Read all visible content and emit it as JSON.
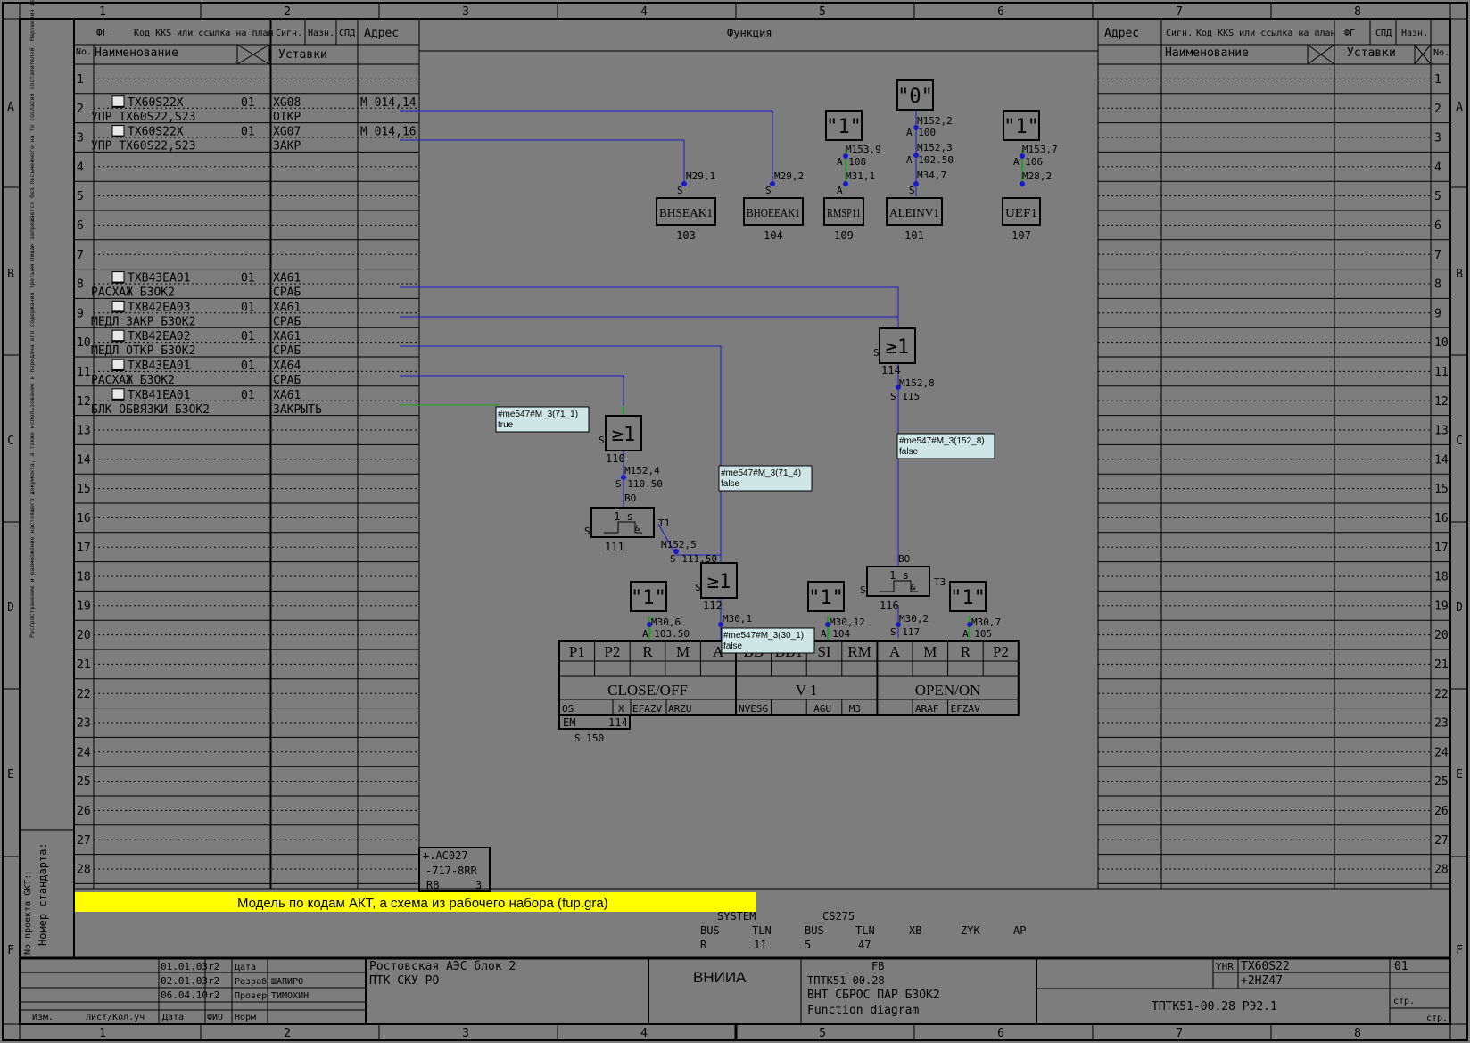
{
  "ruler": {
    "cols": [
      "1",
      "2",
      "3",
      "4",
      "5",
      "6",
      "7",
      "8"
    ],
    "rows": [
      "A",
      "B",
      "C",
      "D",
      "E",
      "F"
    ]
  },
  "left_header": {
    "fg": "ФГ",
    "kks": "Код KKS или ссылка на план",
    "sign": "Сигн.",
    "nazn": "Назн.",
    "spd": "СПД",
    "addr": "Адрес",
    "no": "No.",
    "name": "Наименование",
    "ustavki": "Уставки"
  },
  "function_header": "Функция",
  "right_header": {
    "addr": "Адрес",
    "sign": "Сигн.",
    "kks": "Код KKS или ссылка на план",
    "fg": "ФГ",
    "spd": "СПД",
    "nazn": "Назн.",
    "name": "Наименование",
    "ustavki": "Уставки",
    "no": "No."
  },
  "row_numbers": [
    "1",
    "2",
    "3",
    "4",
    "5",
    "6",
    "7",
    "8",
    "9",
    "10",
    "11",
    "12",
    "13",
    "14",
    "15",
    "16",
    "17",
    "18",
    "19",
    "20",
    "21",
    "22",
    "23",
    "24",
    "25",
    "26",
    "27",
    "28"
  ],
  "signals": [
    {
      "row": 2,
      "kks": "TX60S22X",
      "fg": "01",
      "sign": "XG08",
      "addr": "M 014,14",
      "name": "УПР TX60S22,S23",
      "ust": "ОТКР"
    },
    {
      "row": 3,
      "kks": "TX60S22X",
      "fg": "01",
      "sign": "XG07",
      "addr": "M 014,16",
      "name": "УПР TX60S22,S23",
      "ust": "ЗАКР"
    },
    {
      "row": 8,
      "kks": "TXB43EA01",
      "fg": "01",
      "sign": "XA61",
      "addr": "",
      "name": "РАСХАЖ БЗОК2",
      "ust": "СРАБ"
    },
    {
      "row": 9,
      "kks": "TXB42EA03",
      "fg": "01",
      "sign": "XA61",
      "addr": "",
      "name": "МЕДЛ ЗАКР БЗОК2",
      "ust": "СРАБ"
    },
    {
      "row": 10,
      "kks": "TXB42EA02",
      "fg": "01",
      "sign": "XA61",
      "addr": "",
      "name": "МЕДЛ ОТКР БЗОК2",
      "ust": "СРАБ"
    },
    {
      "row": 11,
      "kks": "TXB43EA01",
      "fg": "01",
      "sign": "XA64",
      "addr": "",
      "name": "РАСХАЖ БЗОК2",
      "ust": "СРАБ"
    },
    {
      "row": 12,
      "kks": "TXB41EA01",
      "fg": "01",
      "sign": "XA61",
      "addr": "",
      "name": "БЛК ОБВЯЗКИ БЗОК2",
      "ust": "ЗАКРЫТЬ"
    }
  ],
  "blocks": [
    {
      "id": "bhseak1",
      "label": "BHSEAK1",
      "num": "103",
      "pin": "M29,1",
      "pinprefix": "S"
    },
    {
      "id": "bhoeeak1",
      "label": "BHOEEAK1",
      "num": "104",
      "pin": "M29,2",
      "pinprefix": "S"
    },
    {
      "id": "rmsp11",
      "label": "RMSP11",
      "num": "109",
      "pin1": "M153,9",
      "pin1b": "A 108",
      "pin2": "M31,1",
      "pinprefix": "A"
    },
    {
      "id": "aleinv1",
      "label": "ALEINV1",
      "num": "101",
      "pin1": "M152,2",
      "pin1b": "A 100",
      "pin2": "M152,3",
      "pin2b": "A 102.50",
      "pin3": "M34,7",
      "pinprefix": "S"
    },
    {
      "id": "uef1",
      "label": "UEF1",
      "num": "107",
      "pin1": "M153,7",
      "pin1b": "A 106",
      "pin2": "M28,2"
    }
  ],
  "consts": {
    "c0": "\"0\"",
    "c1": "\"1\""
  },
  "or_blocks": {
    "or114": {
      "label": "≥1",
      "num": "114",
      "pin": "M152,8",
      "pinb": "S 115"
    },
    "or110": {
      "label": "≥1",
      "num": "110",
      "pin": "M152,4",
      "pinb": "S 110.50",
      "bo": "BO"
    },
    "or112": {
      "label": "≥1",
      "num": "112",
      "pin": "M30,1"
    }
  },
  "timers": {
    "t1": {
      "label": "1 s",
      "num": "111",
      "name": "T1",
      "pin": "M152,5",
      "pinb": "S 111.50"
    },
    "t3": {
      "label": "1 s",
      "num": "116",
      "name": "T3",
      "bo": "BO",
      "pin": "M30,2",
      "pinb": "S 117"
    }
  },
  "small_consts": [
    {
      "id": "k1",
      "pin": "M30,6",
      "pinb": "A 103.50"
    },
    {
      "id": "k2",
      "pin": "M30,12",
      "pinb": "A 104"
    },
    {
      "id": "k3",
      "pin": "M30,7",
      "pinb": "A 105"
    }
  ],
  "tooltips": [
    {
      "id": "tt1",
      "line1": "#me547#M_3(71_1)",
      "line2": "true"
    },
    {
      "id": "tt2",
      "line1": "#me547#M_3(71_4)",
      "line2": "false"
    },
    {
      "id": "tt3",
      "line1": "#me547#M_3(152_8)",
      "line2": "false"
    },
    {
      "id": "tt4",
      "line1": "#me547#M_3(30_1)",
      "line2": "false"
    }
  ],
  "drive_table": {
    "headers": [
      "P1",
      "P2",
      "R",
      "M",
      "A",
      "BB",
      "BB1",
      "SI",
      "RM",
      "A",
      "M",
      "R",
      "P2"
    ],
    "groups": [
      "CLOSE/OFF",
      "V 1",
      "OPEN/ON"
    ],
    "row3": [
      "OS",
      "X",
      "EFAZV",
      "ARZU",
      "NVESG",
      "AGU",
      "M3",
      "ARAF",
      "EFZAV"
    ],
    "em": "EM",
    "em_val": "114",
    "s150": "S  150"
  },
  "ref_box": {
    "l1": "+.AC027",
    "l2": "-717-8RR",
    "l3": "RB",
    "l4": "3"
  },
  "note": "Модель по кодам АКТ, а схема из рабочего набора (fup.gra)",
  "system": {
    "system": "SYSTEM",
    "cs": "CS275",
    "bus1": "BUS",
    "tln1": "TLN",
    "bus2": "BUS",
    "tln2": "TLN",
    "xb": "XB",
    "zyk": "ZYK",
    "ap": "AP",
    "v_r": "R",
    "v_11": "11",
    "v_5": "5",
    "v_47": "47"
  },
  "vertical_texts": {
    "legal": "Распространение и размножение настоящего документа, а также использование и передача его содержания третьим лицам запрещается без письменного на то согласия составителей. Нарушения данного положения обязывают к компенсации ущерба. Сохраняем за собой все права на случай выдачи патента или внесения в реестр",
    "project": "No проекта GKT:",
    "standard": "Номер стандарта:"
  },
  "title_block": {
    "d1": "01.01.03",
    "r1": "r2",
    "l1": "Дата",
    "d2": "02.01.03",
    "r2": "r2",
    "l2": "Разраб",
    "n2": "ШАПИРО",
    "d3": "06.04.10",
    "r3": "r2",
    "l3": "Провер",
    "n3": "ТИМОХИН",
    "h1": "Изм.",
    "h2": "Лист/Кол.уч",
    "h3": "Дата",
    "h4": "ФИО",
    "h5": "Норм",
    "plant": "Ростовская АЭС блок 2",
    "system": "ПТК СКУ РО",
    "org": "ВНИИА",
    "fb": "FB",
    "code": "ТПТК51-00.28",
    "title": "ВНТ СБРОС ПАР БЗОК2",
    "subtitle": "Function diagram",
    "yhr": "YHR",
    "kks": "TX60S22",
    "kks2": "+2HZ47",
    "sheet": "01",
    "doc": "ТПТК51-00.28 РЭ2.1",
    "str1": "стр.",
    "str2": "стр."
  },
  "colors": {
    "background": "#7d7d7d",
    "lines": "#000000",
    "wire": "#1a1acc",
    "green": "#1fa31f",
    "note_bg": "#ffff00",
    "tooltip_bg": "#cfe6e6"
  }
}
